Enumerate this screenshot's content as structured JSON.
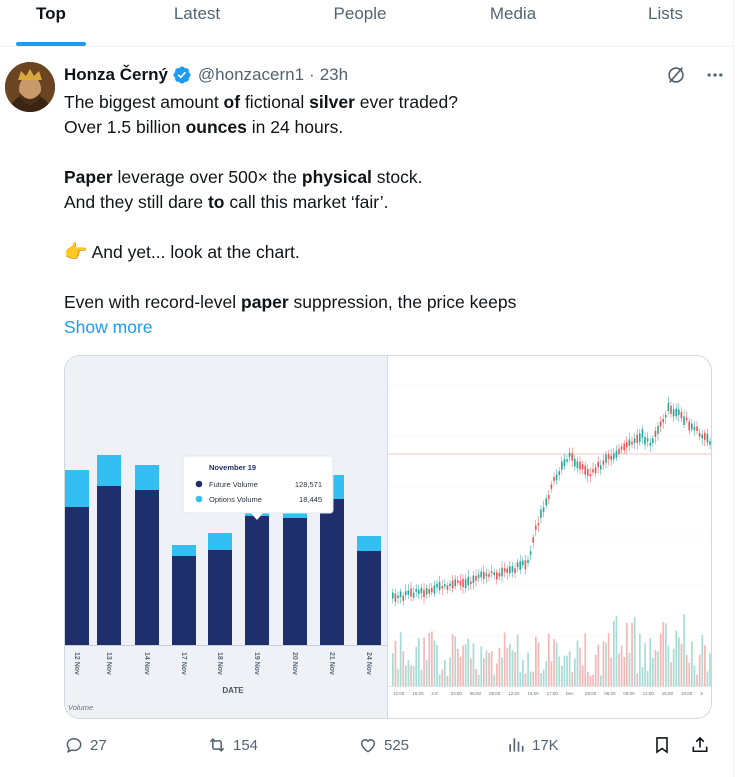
{
  "tabs": [
    {
      "label": "Top",
      "active": true
    },
    {
      "label": "Latest"
    },
    {
      "label": "People"
    },
    {
      "label": "Media"
    },
    {
      "label": "Lists"
    }
  ],
  "tweet": {
    "author_name": "Honza Černý",
    "handle": "@honzacern1",
    "separator": "·",
    "time": "23h",
    "show_more": "Show more"
  },
  "chart_images": {
    "left": {
      "type": "bar",
      "categories": [
        "12 Nov",
        "13 Nov",
        "14 Nov",
        "17 Nov",
        "18 Nov",
        "19 Nov",
        "20 Nov",
        "21 Nov",
        "24 Nov"
      ],
      "xlabel": "DATE",
      "corner_label": "Volume",
      "series": [
        {
          "name": "Future Volume",
          "color": "#1f2f6b"
        },
        {
          "name": "Options Volume",
          "color": "#34bff2"
        }
      ],
      "tooltip": {
        "title": "November 19",
        "rows": [
          {
            "label": "Future Volume",
            "value": "128,571"
          },
          {
            "label": "Options Volume",
            "value": "18,445"
          }
        ]
      }
    },
    "right": {
      "type": "candlestick",
      "x_ticks": [
        "12:00",
        "15:00",
        "2.8",
        "03:00",
        "06:00",
        "09:00",
        "12:00",
        "15:00",
        "17:00",
        "Dec",
        "03:00",
        "06:00",
        "09:00",
        "12:00",
        "15:00",
        "18:00",
        "3"
      ]
    }
  },
  "actions": {
    "replies": "27",
    "reposts": "154",
    "likes": "525",
    "views": "17K"
  },
  "colors": {
    "accent": "#1d9bf0",
    "up_candle": "#26a69a",
    "down_candle": "#ef5350"
  }
}
